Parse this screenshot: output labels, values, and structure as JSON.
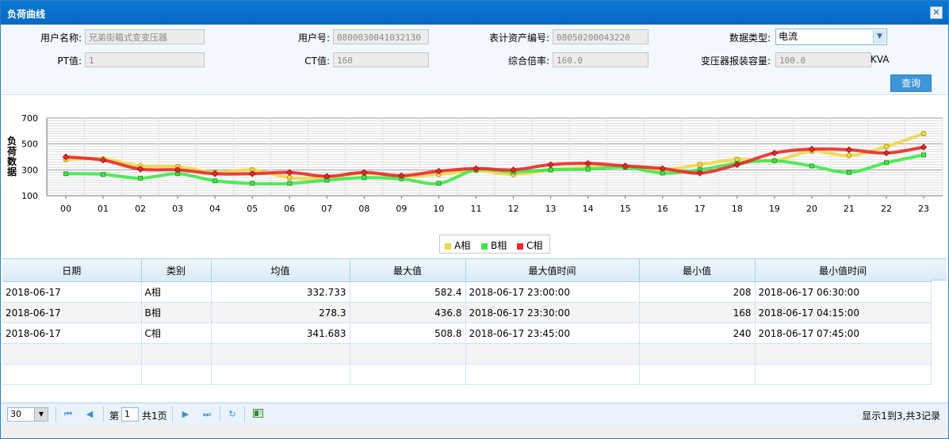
{
  "window": {
    "title": "负荷曲线",
    "close": "✕"
  },
  "form": {
    "user_name_label": "用户名称:",
    "user_name_value": "兄弟街箱式变变压器",
    "user_no_label": "用户号:",
    "user_no_value": "0800030041032130",
    "meter_no_label": "表计资产编号:",
    "meter_no_value": "08050200043220",
    "data_type_label": "数据类型:",
    "data_type_value": "电流",
    "pt_label": "PT值:",
    "pt_value": "1",
    "ct_label": "CT值:",
    "ct_value": "160",
    "ratio_label": "综合倍率:",
    "ratio_value": "160.0",
    "capacity_label": "变压器报装容量:",
    "capacity_value": "100.0",
    "capacity_unit": "KVA",
    "query_button": "查询"
  },
  "chart_data": {
    "type": "line",
    "ylabel": "负荷数据",
    "ylim": [
      100,
      700
    ],
    "yticks": [
      100,
      300,
      500,
      700
    ],
    "categories": [
      "00",
      "01",
      "02",
      "03",
      "04",
      "05",
      "06",
      "07",
      "08",
      "09",
      "10",
      "11",
      "12",
      "13",
      "14",
      "15",
      "16",
      "17",
      "18",
      "19",
      "20",
      "21",
      "22",
      "23"
    ],
    "series": [
      {
        "name": "A相",
        "color": "#f0d84a",
        "marker": "circle",
        "values": [
          380,
          385,
          330,
          325,
          280,
          300,
          240,
          240,
          275,
          250,
          265,
          295,
          265,
          300,
          320,
          330,
          300,
          340,
          380,
          370,
          445,
          410,
          480,
          580
        ]
      },
      {
        "name": "B相",
        "color": "#3fe84a",
        "marker": "square",
        "values": [
          270,
          265,
          235,
          270,
          215,
          195,
          195,
          220,
          240,
          230,
          195,
          300,
          285,
          300,
          305,
          320,
          275,
          300,
          350,
          370,
          330,
          280,
          355,
          415
        ]
      },
      {
        "name": "C相",
        "color": "#ea2a2a",
        "marker": "diamond",
        "values": [
          400,
          375,
          305,
          300,
          270,
          270,
          280,
          250,
          280,
          255,
          290,
          310,
          300,
          340,
          350,
          330,
          310,
          275,
          340,
          430,
          460,
          455,
          430,
          475
        ]
      }
    ],
    "legend": "bottom-center",
    "grid": true
  },
  "table": {
    "headers": [
      "日期",
      "类别",
      "均值",
      "最大值",
      "最大值时间",
      "最小值",
      "最小值时间"
    ],
    "rows": [
      [
        "2018-06-17",
        "A相",
        "332.733",
        "582.4",
        "2018-06-17 23:00:00",
        "208",
        "2018-06-17 06:30:00"
      ],
      [
        "2018-06-17",
        "B相",
        "278.3",
        "436.8",
        "2018-06-17 23:30:00",
        "168",
        "2018-06-17 04:15:00"
      ],
      [
        "2018-06-17",
        "C相",
        "341.683",
        "508.8",
        "2018-06-17 23:45:00",
        "240",
        "2018-06-17 07:45:00"
      ]
    ]
  },
  "pager": {
    "page_size": "30",
    "page_prefix": "第",
    "page_value": "1",
    "page_total": "共1页",
    "info": "显示1到3,共3记录"
  }
}
